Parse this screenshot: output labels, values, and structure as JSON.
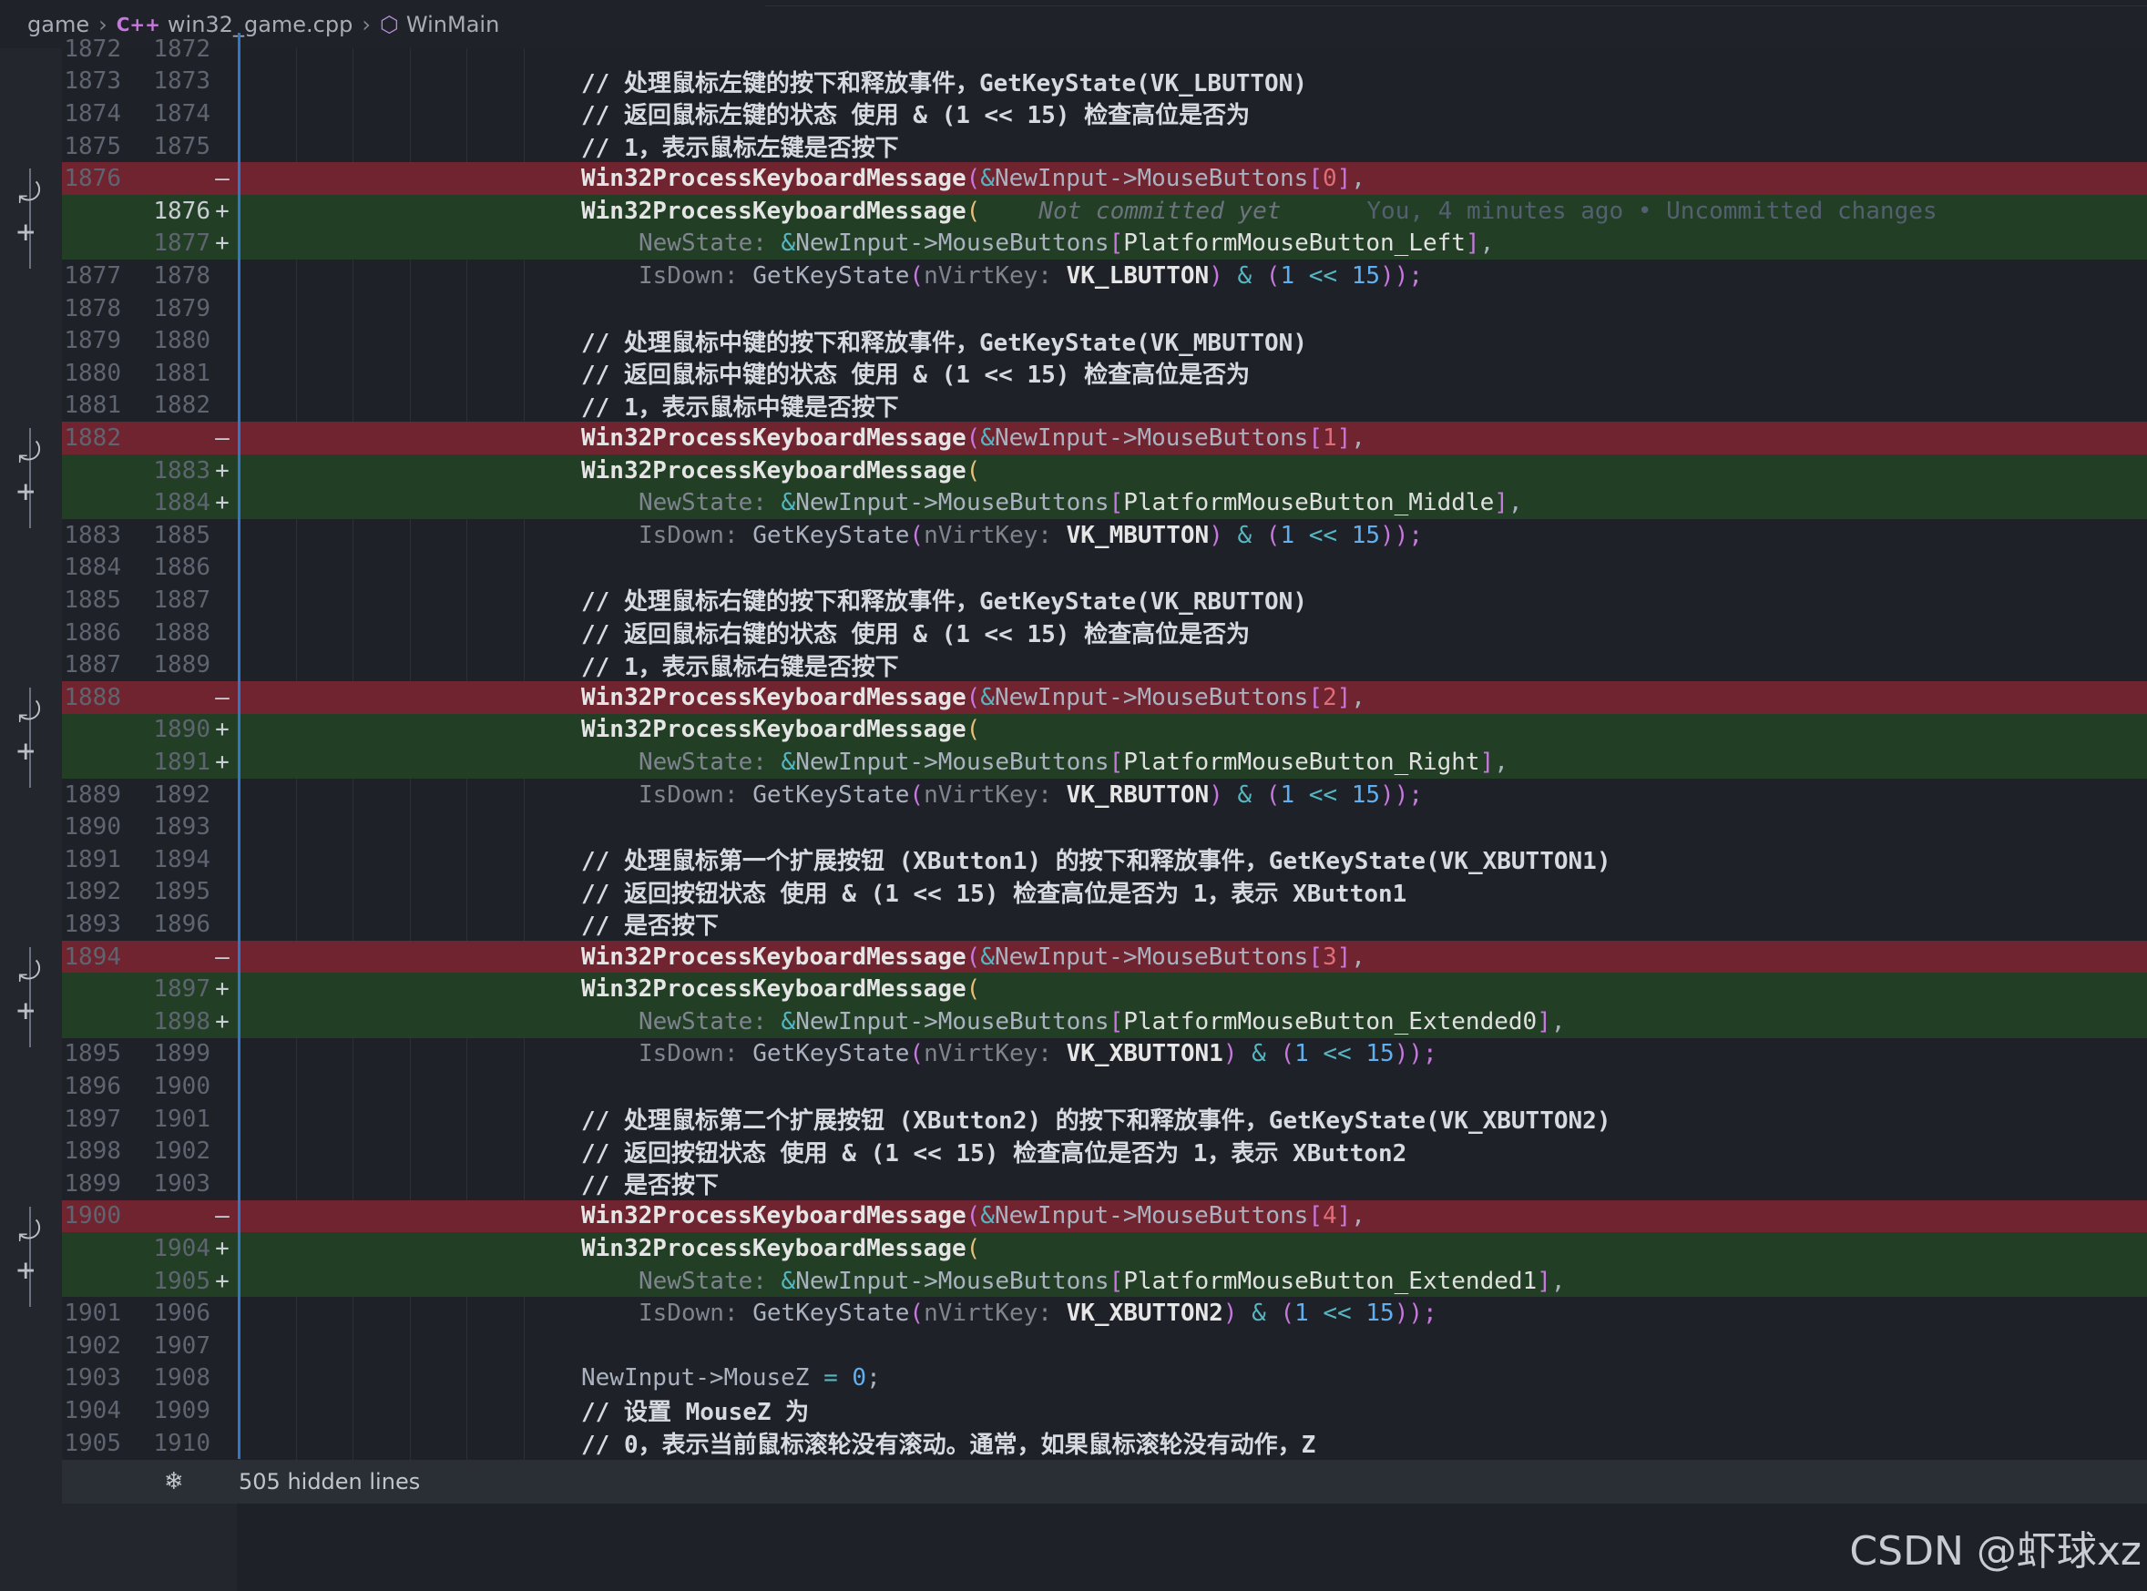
{
  "breadcrumb": {
    "folder": "game",
    "file_icon": "C++",
    "file": "win32_game.cpp",
    "symbol": "WinMain"
  },
  "blame": {
    "not_committed": "Not committed yet",
    "annotation": "You, 4 minutes ago • Uncommitted changes"
  },
  "hidden_lines": "505 hidden lines",
  "watermark": "CSDN @虾球xz",
  "rows": {
    "r0": {
      "old": "1872",
      "new": "1872"
    },
    "r1": {
      "old": "1873",
      "new": "1873",
      "text": "// 处理鼠标左键的按下和释放事件，GetKeyState(VK_LBUTTON)"
    },
    "r2": {
      "old": "1874",
      "new": "1874",
      "text": "// 返回鼠标左键的状态 使用 & (1 << 15) 检查高位是否为"
    },
    "r3": {
      "old": "1875",
      "new": "1875",
      "text": "// 1，表示鼠标左键是否按下"
    },
    "r4": {
      "old": "1876",
      "sign": "—",
      "fn": "Win32ProcessKeyboardMessage",
      "amp": "&",
      "rest": "NewInput->MouseButtons",
      "lb": "[",
      "idx": "0",
      "rb": "]",
      "tail": ","
    },
    "r5": {
      "new": "1876",
      "sign": "+",
      "fn": "Win32ProcessKeyboardMessage",
      "paren": "("
    },
    "r6": {
      "new": "1877",
      "sign": "+",
      "hint": "NewState:",
      "amp": "&",
      "rest": "NewInput->MouseButtons",
      "lb": "[",
      "idx": "PlatformMouseButton_Left",
      "rb": "]",
      "tail": ","
    },
    "r7": {
      "old": "1877",
      "new": "1878",
      "hint": "IsDown:",
      "call": "GetKeyState",
      "lp": "(",
      "hint2": "nVirtKey:",
      "kw": "VK_LBUTTON",
      "rp": ")",
      "op": "&",
      "lp2": "(",
      "one": "1",
      "shift": "<<",
      "fifteen": "15",
      "end": "));"
    },
    "r8": {
      "old": "1878",
      "new": "1879"
    },
    "r9": {
      "old": "1879",
      "new": "1880",
      "text": "// 处理鼠标中键的按下和释放事件，GetKeyState(VK_MBUTTON)"
    },
    "r10": {
      "old": "1880",
      "new": "1881",
      "text": "// 返回鼠标中键的状态 使用 & (1 << 15) 检查高位是否为"
    },
    "r11": {
      "old": "1881",
      "new": "1882",
      "text": "// 1，表示鼠标中键是否按下"
    },
    "r12": {
      "old": "1882",
      "sign": "—",
      "fn": "Win32ProcessKeyboardMessage",
      "amp": "&",
      "rest": "NewInput->MouseButtons",
      "lb": "[",
      "idx": "1",
      "rb": "]",
      "tail": ","
    },
    "r13": {
      "new": "1883",
      "sign": "+",
      "fn": "Win32ProcessKeyboardMessage",
      "paren": "("
    },
    "r14": {
      "new": "1884",
      "sign": "+",
      "hint": "NewState:",
      "amp": "&",
      "rest": "NewInput->MouseButtons",
      "lb": "[",
      "idx": "PlatformMouseButton_Middle",
      "rb": "]",
      "tail": ","
    },
    "r15": {
      "old": "1883",
      "new": "1885",
      "hint": "IsDown:",
      "call": "GetKeyState",
      "lp": "(",
      "hint2": "nVirtKey:",
      "kw": "VK_MBUTTON",
      "rp": ")",
      "op": "&",
      "lp2": "(",
      "one": "1",
      "shift": "<<",
      "fifteen": "15",
      "end": "));"
    },
    "r16": {
      "old": "1884",
      "new": "1886"
    },
    "r17": {
      "old": "1885",
      "new": "1887",
      "text": "// 处理鼠标右键的按下和释放事件，GetKeyState(VK_RBUTTON)"
    },
    "r18": {
      "old": "1886",
      "new": "1888",
      "text": "// 返回鼠标右键的状态 使用 & (1 << 15) 检查高位是否为"
    },
    "r19": {
      "old": "1887",
      "new": "1889",
      "text": "// 1，表示鼠标右键是否按下"
    },
    "r20": {
      "old": "1888",
      "sign": "—",
      "fn": "Win32ProcessKeyboardMessage",
      "amp": "&",
      "rest": "NewInput->MouseButtons",
      "lb": "[",
      "idx": "2",
      "rb": "]",
      "tail": ","
    },
    "r21": {
      "new": "1890",
      "sign": "+",
      "fn": "Win32ProcessKeyboardMessage",
      "paren": "("
    },
    "r22": {
      "new": "1891",
      "sign": "+",
      "hint": "NewState:",
      "amp": "&",
      "rest": "NewInput->MouseButtons",
      "lb": "[",
      "idx": "PlatformMouseButton_Right",
      "rb": "]",
      "tail": ","
    },
    "r23": {
      "old": "1889",
      "new": "1892",
      "hint": "IsDown:",
      "call": "GetKeyState",
      "lp": "(",
      "hint2": "nVirtKey:",
      "kw": "VK_RBUTTON",
      "rp": ")",
      "op": "&",
      "lp2": "(",
      "one": "1",
      "shift": "<<",
      "fifteen": "15",
      "end": "));"
    },
    "r24": {
      "old": "1890",
      "new": "1893"
    },
    "r25": {
      "old": "1891",
      "new": "1894",
      "text": "// 处理鼠标第一个扩展按钮 (XButton1) 的按下和释放事件，GetKeyState(VK_XBUTTON1)"
    },
    "r26": {
      "old": "1892",
      "new": "1895",
      "text": "// 返回按钮状态 使用 & (1 << 15) 检查高位是否为 1，表示 XButton1"
    },
    "r27": {
      "old": "1893",
      "new": "1896",
      "text": "// 是否按下"
    },
    "r28": {
      "old": "1894",
      "sign": "—",
      "fn": "Win32ProcessKeyboardMessage",
      "amp": "&",
      "rest": "NewInput->MouseButtons",
      "lb": "[",
      "idx": "3",
      "rb": "]",
      "tail": ","
    },
    "r29": {
      "new": "1897",
      "sign": "+",
      "fn": "Win32ProcessKeyboardMessage",
      "paren": "("
    },
    "r30": {
      "new": "1898",
      "sign": "+",
      "hint": "NewState:",
      "amp": "&",
      "rest": "NewInput->MouseButtons",
      "lb": "[",
      "idx": "PlatformMouseButton_Extended0",
      "rb": "]",
      "tail": ","
    },
    "r31": {
      "old": "1895",
      "new": "1899",
      "hint": "IsDown:",
      "call": "GetKeyState",
      "lp": "(",
      "hint2": "nVirtKey:",
      "kw": "VK_XBUTTON1",
      "rp": ")",
      "op": "&",
      "lp2": "(",
      "one": "1",
      "shift": "<<",
      "fifteen": "15",
      "end": "));"
    },
    "r32": {
      "old": "1896",
      "new": "1900"
    },
    "r33": {
      "old": "1897",
      "new": "1901",
      "text": "// 处理鼠标第二个扩展按钮 (XButton2) 的按下和释放事件，GetKeyState(VK_XBUTTON2)"
    },
    "r34": {
      "old": "1898",
      "new": "1902",
      "text": "// 返回按钮状态 使用 & (1 << 15) 检查高位是否为 1，表示 XButton2"
    },
    "r35": {
      "old": "1899",
      "new": "1903",
      "text": "// 是否按下"
    },
    "r36": {
      "old": "1900",
      "sign": "—",
      "fn": "Win32ProcessKeyboardMessage",
      "amp": "&",
      "rest": "NewInput->MouseButtons",
      "lb": "[",
      "idx": "4",
      "rb": "]",
      "tail": ","
    },
    "r37": {
      "new": "1904",
      "sign": "+",
      "fn": "Win32ProcessKeyboardMessage",
      "paren": "("
    },
    "r38": {
      "new": "1905",
      "sign": "+",
      "hint": "NewState:",
      "amp": "&",
      "rest": "NewInput->MouseButtons",
      "lb": "[",
      "idx": "PlatformMouseButton_Extended1",
      "rb": "]",
      "tail": ","
    },
    "r39": {
      "old": "1901",
      "new": "1906",
      "hint": "IsDown:",
      "call": "GetKeyState",
      "lp": "(",
      "hint2": "nVirtKey:",
      "kw": "VK_XBUTTON2",
      "rp": ")",
      "op": "&",
      "lp2": "(",
      "one": "1",
      "shift": "<<",
      "fifteen": "15",
      "end": "));"
    },
    "r40": {
      "old": "1902",
      "new": "1907"
    },
    "r41": {
      "old": "1903",
      "new": "1908",
      "assign_lhs": "NewInput->MouseZ",
      "assign_op": "=",
      "assign_val": "0",
      "semi": ";"
    },
    "r42": {
      "old": "1904",
      "new": "1909",
      "text": "// 设置 MouseZ 为"
    },
    "r43": {
      "old": "1905",
      "new": "1910",
      "text": "// 0，表示当前鼠标滚轮没有滚动。通常，如果鼠标滚轮没有动作，Z"
    }
  }
}
